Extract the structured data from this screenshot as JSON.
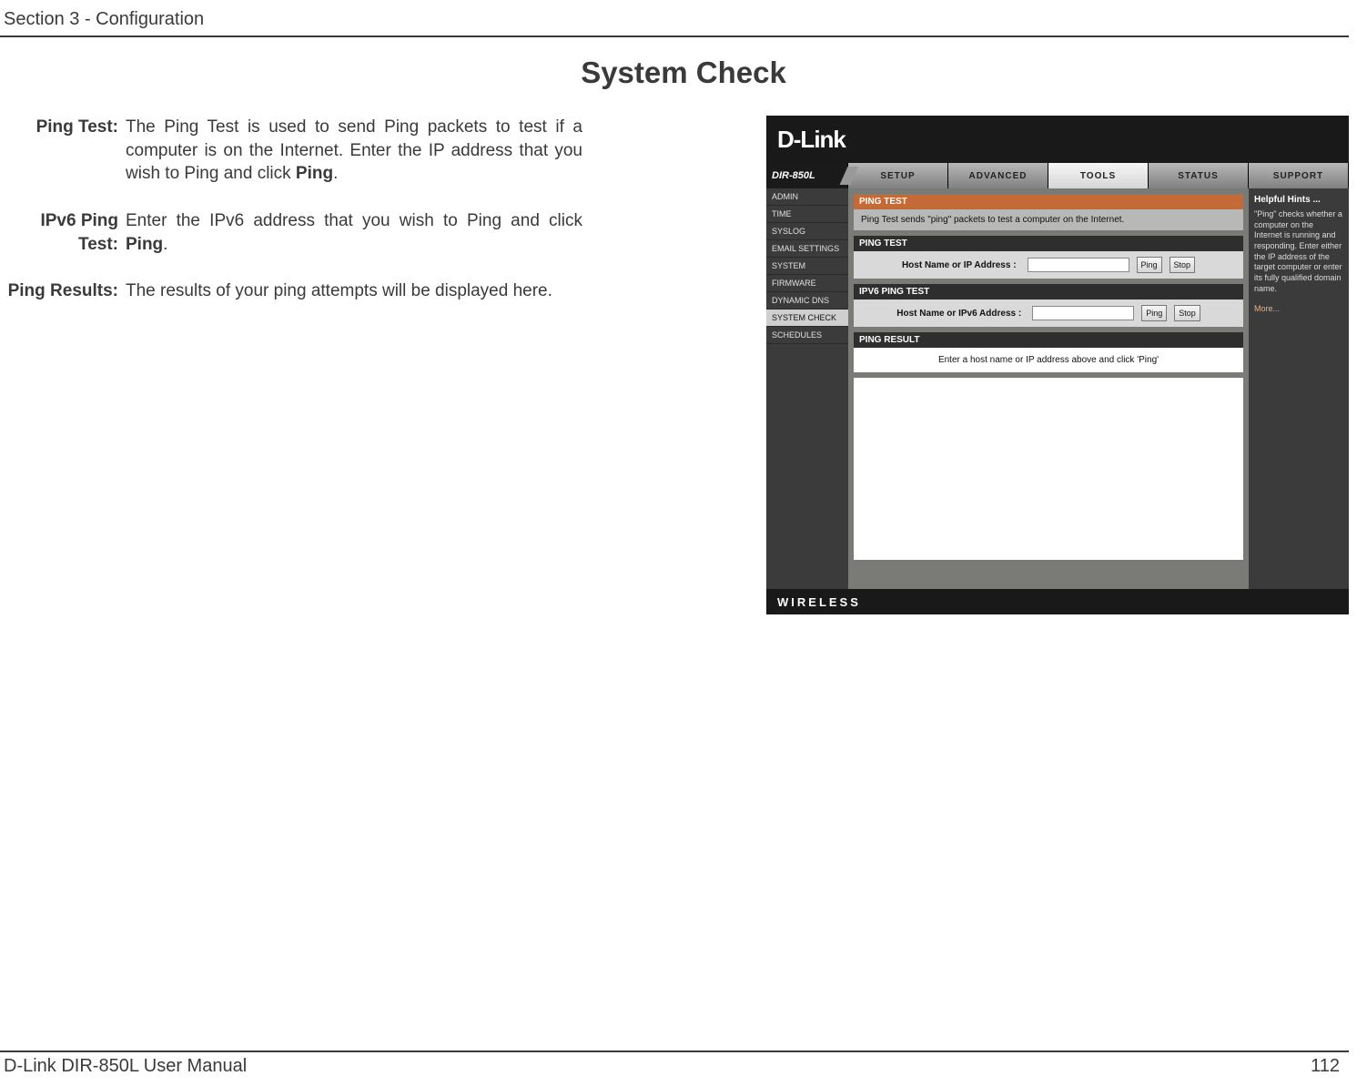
{
  "header": {
    "section": "Section 3 - Configuration"
  },
  "title": "System Check",
  "defs": [
    {
      "label": "Ping Test:",
      "value_before": "The Ping Test is used to send Ping packets to test if a computer is on the Internet. Enter the IP address that you wish to Ping and click ",
      "value_bold": "Ping",
      "value_after": "."
    },
    {
      "label": "IPv6 Ping Test:",
      "value_before": "Enter the IPv6 address that you wish to Ping and click ",
      "value_bold": "Ping",
      "value_after": "."
    },
    {
      "label": "Ping Results:",
      "value_before": "The results of your ping attempts will be displayed here.",
      "value_bold": "",
      "value_after": ""
    }
  ],
  "router": {
    "logo": "D-Link",
    "model": "DIR-850L",
    "tabs": [
      "SETUP",
      "ADVANCED",
      "TOOLS",
      "STATUS",
      "SUPPORT"
    ],
    "active_tab": "TOOLS",
    "nav": [
      "ADMIN",
      "TIME",
      "SYSLOG",
      "EMAIL SETTINGS",
      "SYSTEM",
      "FIRMWARE",
      "DYNAMIC DNS",
      "SYSTEM CHECK",
      "SCHEDULES"
    ],
    "active_nav": "SYSTEM CHECK",
    "ping_test_hdr": "PING TEST",
    "ping_test_desc": "Ping Test sends \"ping\" packets to test a computer on the Internet.",
    "ping_test_panel_hdr": "PING TEST",
    "ping_test_label": "Host Name or IP Address  :",
    "ping_btn": "Ping",
    "stop_btn": "Stop",
    "ipv6_hdr": "IPV6 PING TEST",
    "ipv6_label": "Host Name or IPv6 Address  :",
    "result_hdr": "PING RESULT",
    "result_text": "Enter a host name or IP address above and click 'Ping'",
    "help_hdr": "Helpful Hints ...",
    "help_text": "\"Ping\" checks whether a computer on the Internet is running and responding. Enter either the IP address of the target computer or enter its fully qualified domain name.",
    "help_more": "More...",
    "bottom": "WIRELESS"
  },
  "footer": {
    "left": "D-Link DIR-850L User Manual",
    "right": "112"
  }
}
